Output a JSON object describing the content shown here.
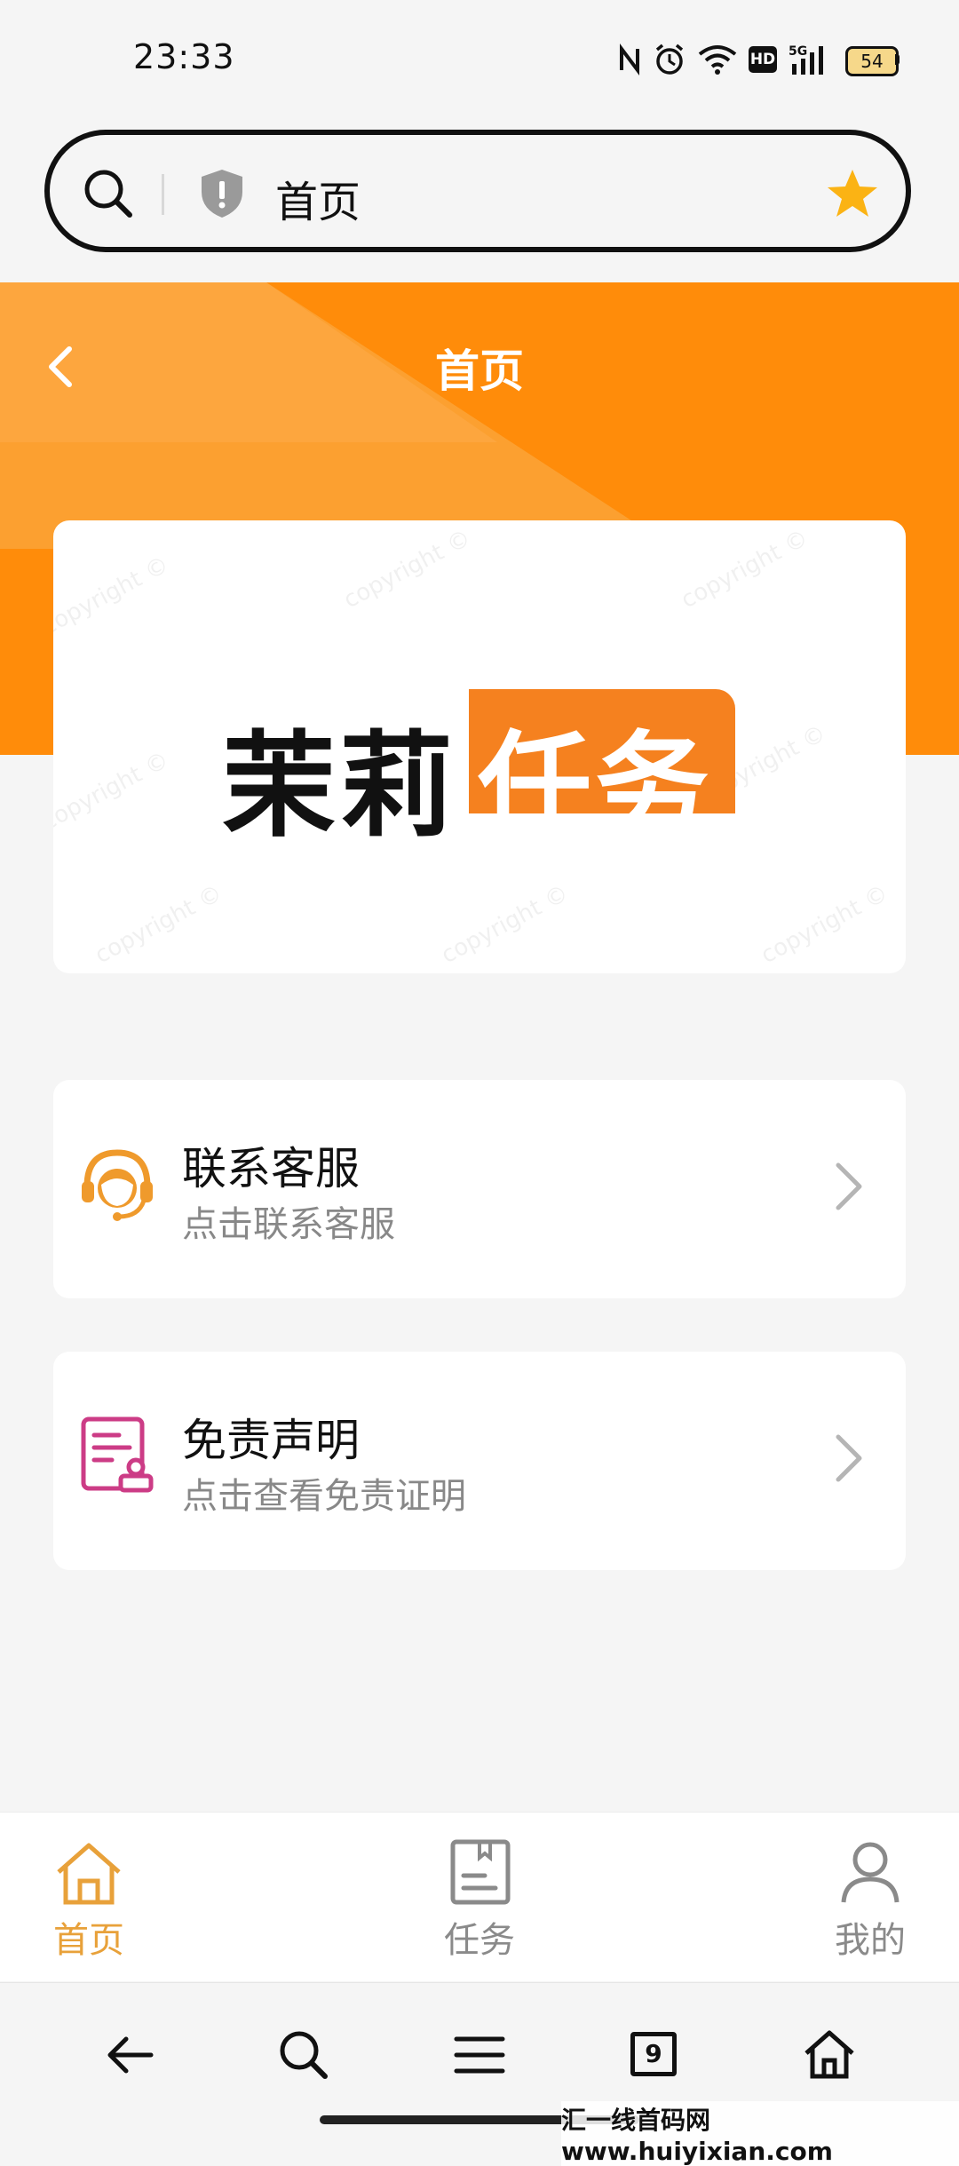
{
  "status_bar": {
    "time": "23:33",
    "battery": "54",
    "icons": [
      "nfc-icon",
      "alarm-icon",
      "wifi-icon",
      "hd-icon",
      "5g-signal-icon",
      "battery-icon"
    ],
    "hd_label": "HD",
    "net_label": "5G"
  },
  "browser": {
    "address_title": "首页",
    "tabs_count": "9"
  },
  "header": {
    "title": "首页",
    "accent_color": "#f9931f"
  },
  "banner": {
    "logo_dark": "茉莉",
    "logo_orange": "任务",
    "watermark": "copyright ©"
  },
  "cards": [
    {
      "title": "联系客服",
      "subtitle": "点击联系客服",
      "icon": "customer-service-icon"
    },
    {
      "title": "免责声明",
      "subtitle": "点击查看免责证明",
      "icon": "disclaimer-document-icon"
    }
  ],
  "tabbar": {
    "items": [
      {
        "label": "首页",
        "icon": "home-icon",
        "active": true
      },
      {
        "label": "任务",
        "icon": "task-icon",
        "active": false
      },
      {
        "label": "我的",
        "icon": "profile-icon",
        "active": false
      }
    ],
    "active_color": "#e8a13a",
    "inactive_color": "#8a8a8a"
  },
  "footer_watermark": "汇一线首码网 www.huiyixian.com"
}
